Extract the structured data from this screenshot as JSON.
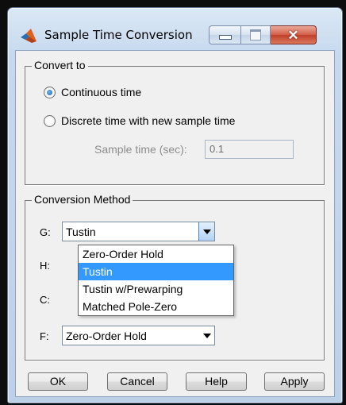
{
  "window": {
    "title": "Sample Time Conversion"
  },
  "convert_to": {
    "group_title": "Convert to",
    "continuous_label": "Continuous time",
    "discrete_label": "Discrete time with new sample time",
    "sample_time_label": "Sample time (sec):",
    "sample_time_value": "0.1",
    "selected": "continuous"
  },
  "conversion_method": {
    "group_title": "Conversion Method",
    "rows": [
      {
        "label": "G:",
        "value": "Tustin"
      },
      {
        "label": "H:",
        "value": ""
      },
      {
        "label": "C:",
        "value": ""
      },
      {
        "label": "F:",
        "value": "Zero-Order Hold"
      }
    ],
    "dropdown_options": [
      "Zero-Order Hold",
      "Tustin",
      "Tustin w/Prewarping",
      "Matched Pole-Zero"
    ],
    "dropdown_selected": "Tustin"
  },
  "buttons": {
    "ok": "OK",
    "cancel": "Cancel",
    "help": "Help",
    "apply": "Apply"
  },
  "icons": {
    "app": "matlab-icon",
    "minimize": "minimize-icon",
    "maximize": "maximize-icon",
    "close": "close-icon"
  }
}
